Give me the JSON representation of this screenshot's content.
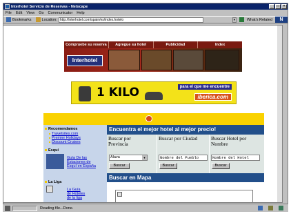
{
  "window": {
    "title": "Interhotel Servicio de Reservas - Netscape"
  },
  "menu": [
    "File",
    "Edit",
    "View",
    "Go",
    "Communicator",
    "Help"
  ],
  "toolbar": {
    "bookmarks_label": "Bookmarks",
    "location_label": "Location:",
    "location_value": "http://interhotel.com/spain/es/index.hotelo",
    "related_label": "What's Related"
  },
  "nav": {
    "items": [
      "Compruebe su reserva",
      "Agregue su hotel",
      "Publicidad",
      "Index"
    ]
  },
  "brand": {
    "name": "Interhotel"
  },
  "banner": {
    "headline": "1 KILO",
    "tagline": "para el que me encuentre",
    "site": "iberica.com"
  },
  "sidebar": {
    "recomendamos": {
      "title": "Recomendamos",
      "links": [
        "Travelsites.com",
        "Premier Holidays",
        "Discount Cruises"
      ]
    },
    "esqui": {
      "title": "Esquí",
      "link": [
        "Guía De las",
        "Estaciones de",
        "Esquí en España"
      ]
    },
    "liga": {
      "title": "La Liga",
      "link": [
        "La Guía",
        "de Hoteles",
        "de la liga"
      ]
    }
  },
  "search": {
    "heading": "Encuentra el mejor hotel al mejor precio!",
    "columns": [
      {
        "title": [
          "Buscar por",
          "Provincia"
        ],
        "select_value": "Alava",
        "button": "Buscar"
      },
      {
        "title": [
          "Buscar por Ciudad"
        ],
        "input_value": "Nombre del Pueblo",
        "button": "Buscar"
      },
      {
        "title": [
          "Buscar Hotel por",
          "Nombre"
        ],
        "input_value": "Nombre del Hotel",
        "button": "Buscar"
      }
    ]
  },
  "map": {
    "heading": "Buscar en Mapa"
  },
  "status": {
    "text": "Reading file...Done."
  },
  "colors": {
    "title_bar": "#0a246a",
    "nav_bar": "#7a1a10",
    "panel_header": "#224f8a",
    "accent_yellow": "#fad200",
    "sidebar_bg": "#c7d5ea"
  }
}
